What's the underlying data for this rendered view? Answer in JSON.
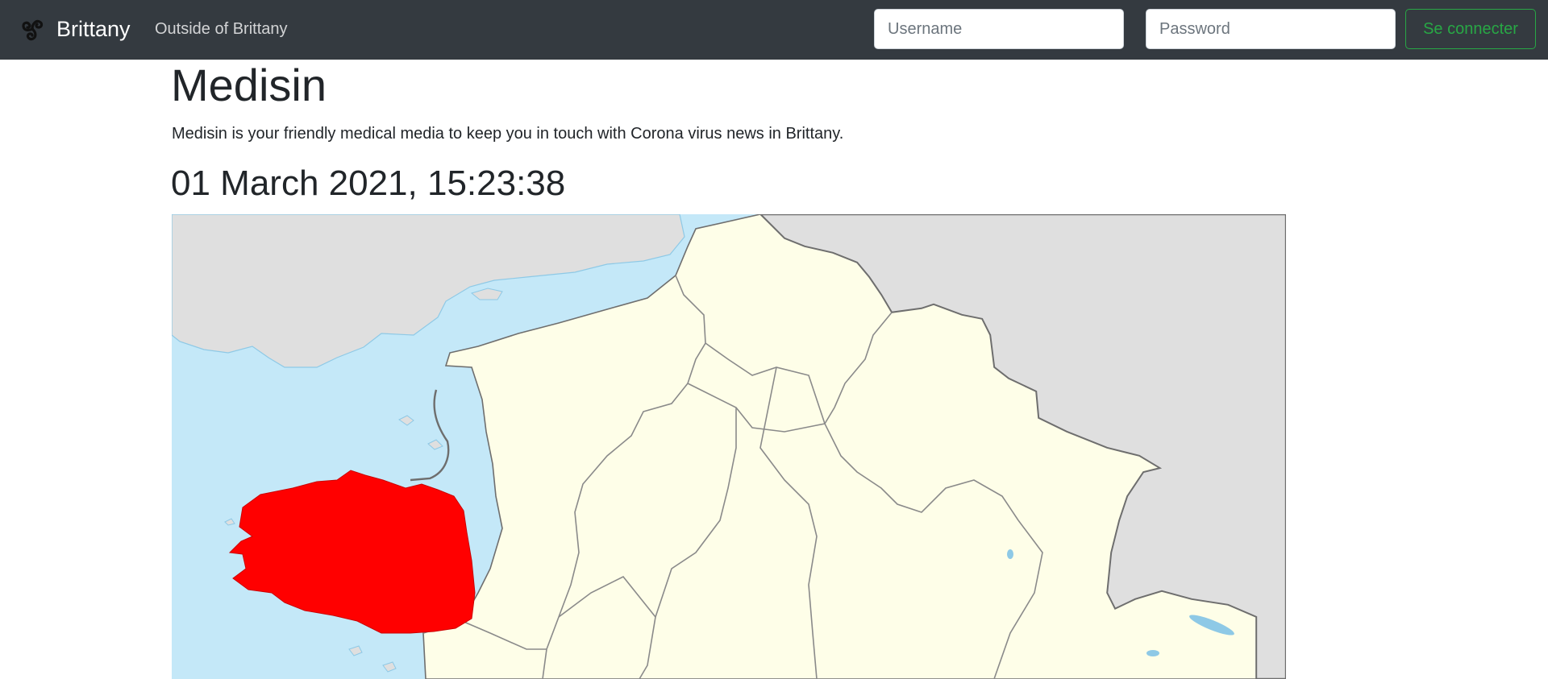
{
  "navbar": {
    "brand_label": "Brittany",
    "brand_icon": "triskelion-icon",
    "nav_link_label": "Outside of Brittany",
    "username_placeholder": "Username",
    "password_placeholder": "Password",
    "connect_label": "Se connecter"
  },
  "main": {
    "title": "Medisin",
    "lead": "Medisin is your friendly medical media to keep you in touch with Corona virus news in Brittany.",
    "datetime": "01 March 2021, 15:23:38"
  },
  "map": {
    "highlighted_region": "Brittany",
    "colors": {
      "sea": "#c4e8f8",
      "foreign_land": "#dfdfdf",
      "french_regions": "#fefee8",
      "highlight": "#ff0000",
      "borders": "#6e6e6e",
      "navbar_bg": "#343a40",
      "connect_accent": "#28a745"
    }
  }
}
